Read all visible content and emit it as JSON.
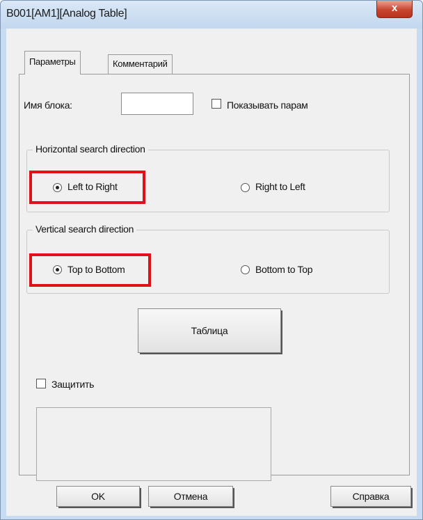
{
  "window": {
    "title": "B001[AM1][Analog Table]",
    "close_glyph": "x"
  },
  "tabs": [
    {
      "label": "Параметры",
      "active": true
    },
    {
      "label": "Комментарий",
      "active": false
    }
  ],
  "block_name": {
    "label": "Имя блока:",
    "value": ""
  },
  "show_params": {
    "label": "Показывать парам",
    "checked": false
  },
  "horizontal": {
    "title": "Horizontal search direction",
    "options": [
      {
        "label": "Left to Right",
        "selected": true
      },
      {
        "label": "Right to Left",
        "selected": false
      }
    ]
  },
  "vertical": {
    "title": "Vertical search direction",
    "options": [
      {
        "label": "Top to Bottom",
        "selected": true
      },
      {
        "label": "Bottom to Top",
        "selected": false
      }
    ]
  },
  "table_button": "Таблица",
  "protect": {
    "label": "Защитить",
    "checked": false
  },
  "footer": {
    "ok": "OK",
    "cancel": "Отмена",
    "help": "Справка"
  },
  "colors": {
    "highlight": "#e0101a",
    "title_bg": "#c7dcf2",
    "close_bg": "#c9452f"
  }
}
